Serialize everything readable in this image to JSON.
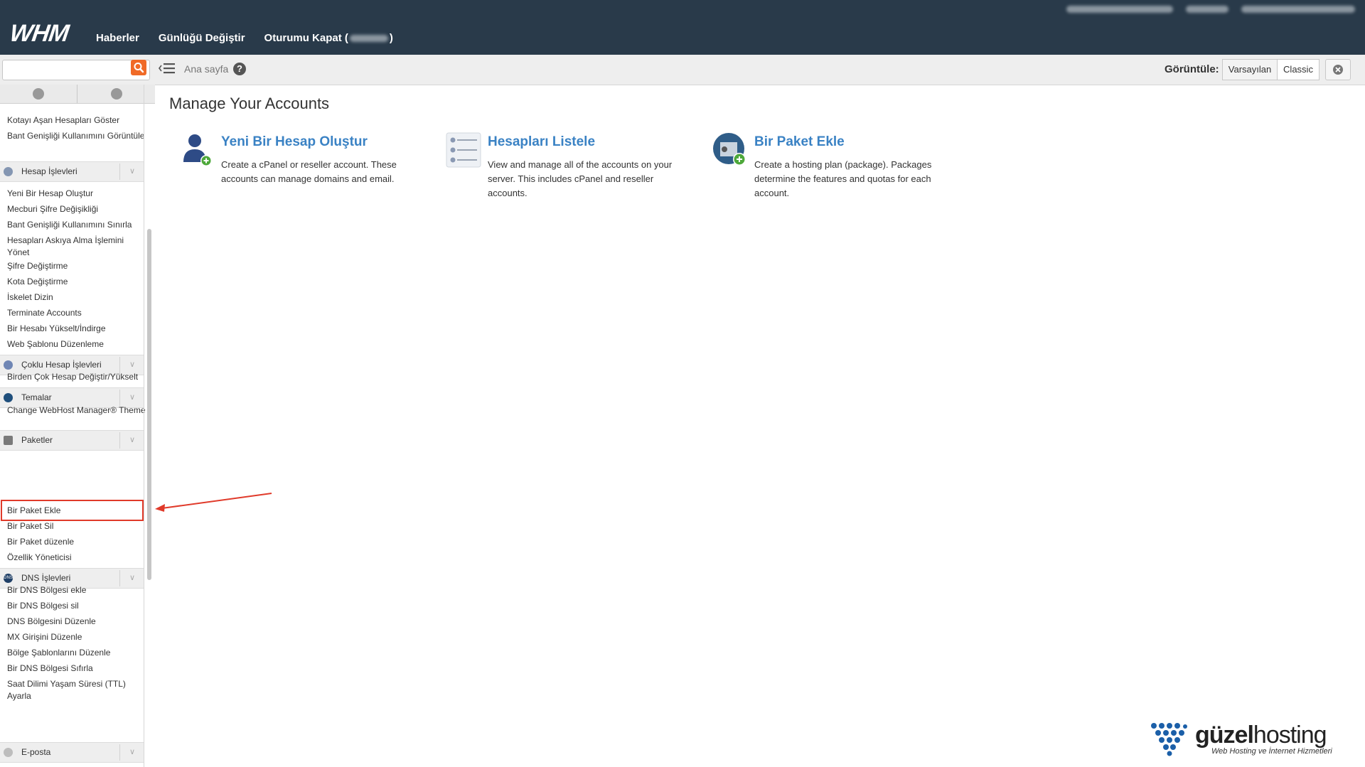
{
  "header": {
    "logo": "WHM",
    "nav": [
      "Haberler",
      "Günlüğü Değiştir",
      "Oturumu Kapat ("
    ],
    "nav_close": ")"
  },
  "toolbar": {
    "breadcrumb": "Ana sayfa",
    "help": "?",
    "view_label": "Görüntüle:",
    "view_default": "Varsayılan",
    "view_classic": "Classic"
  },
  "sidebar": {
    "items_top": [
      "Kotayı Aşan Hesapları Göster",
      "Bant Genişliği Kullanımını Görüntüle"
    ],
    "cat_account": "Hesap İşlevleri",
    "account_items": [
      "Yeni Bir Hesap Oluştur",
      "Mecburi Şifre Değişikliği",
      "Bant Genişliği Kullanımını Sınırla",
      "Hesapları Askıya Alma İşlemini Yönet",
      "Şifre Değiştirme",
      "Kota Değiştirme",
      "İskelet Dizin",
      "Terminate Accounts",
      "Bir Hesabı Yükselt/İndirge",
      "Web Şablonu Düzenleme"
    ],
    "cat_multi": "Çoklu Hesap İşlevleri",
    "multi_items": [
      "Birden Çok Hesap Değiştir/Yükselt"
    ],
    "cat_themes": "Temalar",
    "theme_items": [
      "Change WebHost Manager® Theme"
    ],
    "cat_packages": "Paketler",
    "package_items": [
      "Bir Paket Ekle",
      "Bir Paket Sil",
      "Bir Paket düzenle",
      "Özellik Yöneticisi"
    ],
    "cat_dns": "DNS İşlevleri",
    "dns_items": [
      "Bir DNS Bölgesi ekle",
      "Bir DNS Bölgesi sil",
      "DNS Bölgesini Düzenle",
      "MX Girişini Düzenle",
      "Bölge Şablonlarını Düzenle",
      "Bir DNS Bölgesi Sıfırla",
      "Saat Dilimi Yaşam Süresi (TTL) Ayarla"
    ],
    "cat_email": "E-posta",
    "dns_icon_text": "DNS"
  },
  "main": {
    "title": "Manage Your Accounts",
    "cards": [
      {
        "title": "Yeni Bir Hesap Oluştur",
        "desc": "Create a cPanel or reseller account. These accounts can manage domains and email."
      },
      {
        "title": "Hesapları Listele",
        "desc": "View and manage all of the accounts on your server. This includes cPanel and reseller accounts."
      },
      {
        "title": "Bir Paket Ekle",
        "desc": "Create a hosting plan (package). Packages determine the features and quotas for each account."
      }
    ]
  },
  "watermark": {
    "brand_a": "güzel",
    "brand_b": "hosting",
    "tagline": "Web Hosting ve İnternet Hizmetleri"
  },
  "colors": {
    "header_bg": "#293a4a",
    "link": "#3a82c4",
    "search_button": "#f06a27",
    "highlight": "#e03a2a"
  }
}
